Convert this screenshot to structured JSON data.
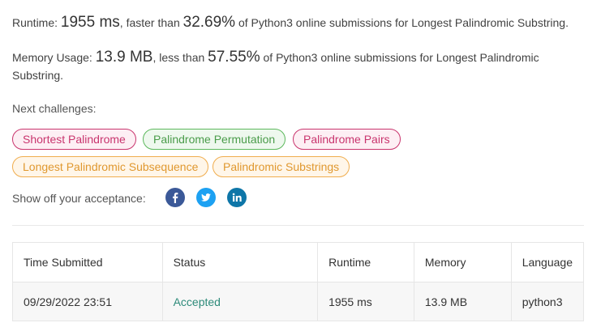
{
  "runtime": {
    "label": "Runtime: ",
    "value": "1955 ms",
    "middle": ", faster than ",
    "percent": "32.69%",
    "suffix": " of Python3 online submissions for Longest Palindromic Substring."
  },
  "memory": {
    "label": "Memory Usage: ",
    "value": "13.9 MB",
    "middle": ", less than ",
    "percent": "57.55%",
    "suffix": " of Python3 online submissions for Longest Palindromic Substring."
  },
  "next_challenges": {
    "label": "Next challenges:",
    "items": [
      {
        "label": "Shortest Palindrome",
        "difficulty": "hard"
      },
      {
        "label": "Palindrome Permutation",
        "difficulty": "easy"
      },
      {
        "label": "Palindrome Pairs",
        "difficulty": "hard"
      },
      {
        "label": "Longest Palindromic Subsequence",
        "difficulty": "medium"
      },
      {
        "label": "Palindromic Substrings",
        "difficulty": "medium"
      }
    ]
  },
  "share": {
    "label": "Show off your acceptance:",
    "icons": [
      {
        "name": "facebook-icon",
        "color": "#3b5998"
      },
      {
        "name": "twitter-icon",
        "color": "#1da1f2"
      },
      {
        "name": "linkedin-icon",
        "color": "#0e76a8"
      }
    ]
  },
  "submissions": {
    "headers": [
      "Time Submitted",
      "Status",
      "Runtime",
      "Memory",
      "Language"
    ],
    "rows": [
      [
        "09/29/2022 23:51",
        "Accepted",
        "1955 ms",
        "13.9 MB",
        "python3"
      ]
    ]
  }
}
